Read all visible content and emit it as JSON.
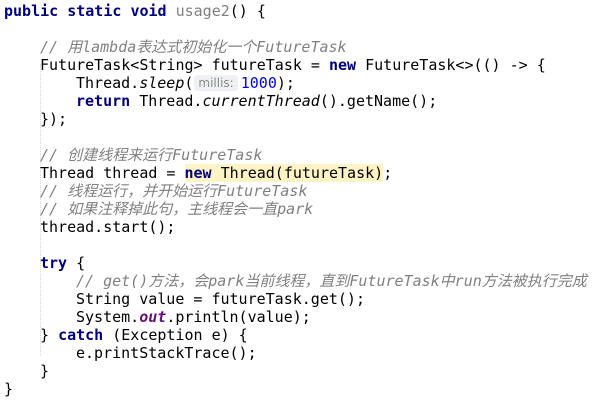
{
  "code": {
    "l1": {
      "kw_public": "public",
      "kw_static": "static",
      "kw_void": "void",
      "method": "usage2",
      "rest": "() {"
    },
    "l3": {
      "comment": "// 用lambda表达式初始化一个FutureTask"
    },
    "l4": {
      "a": "FutureTask<String> futureTask = ",
      "kw_new": "new",
      "b": " FutureTask<>(() -> {"
    },
    "l5": {
      "a": "Thread.",
      "sleep": "sleep",
      "b": "(",
      "hint": "millis:",
      "num": "1000",
      "c": ");"
    },
    "l6": {
      "kw_return": "return",
      "a": " Thread.",
      "current": "currentThread",
      "b": "().getName();"
    },
    "l7": {
      "a": "});"
    },
    "l9": {
      "comment": "// 创建线程来运行FutureTask"
    },
    "l10": {
      "a": "Thread thread = ",
      "kw_new": "new",
      "b": " Thread(futureTask)",
      "c": ";"
    },
    "l11": {
      "comment": "// 线程运行，并开始运行FutureTask"
    },
    "l12": {
      "comment": "// 如果注释掉此句，主线程会一直park"
    },
    "l13": {
      "a": "thread.start();"
    },
    "l15": {
      "kw_try": "try",
      "a": " {"
    },
    "l16": {
      "comment": "// get()方法，会park当前线程，直到FutureTask中run方法被执行完成"
    },
    "l17": {
      "a": "String value = futureTask.get();"
    },
    "l18": {
      "a": "System.",
      "out": "out",
      "b": ".println(value);"
    },
    "l19": {
      "a": "} ",
      "kw_catch": "catch",
      "b": " (Exception e) {"
    },
    "l20": {
      "a": "e.printStackTrace();"
    },
    "l21": {
      "a": "}"
    },
    "l22": {
      "a": "}"
    }
  }
}
